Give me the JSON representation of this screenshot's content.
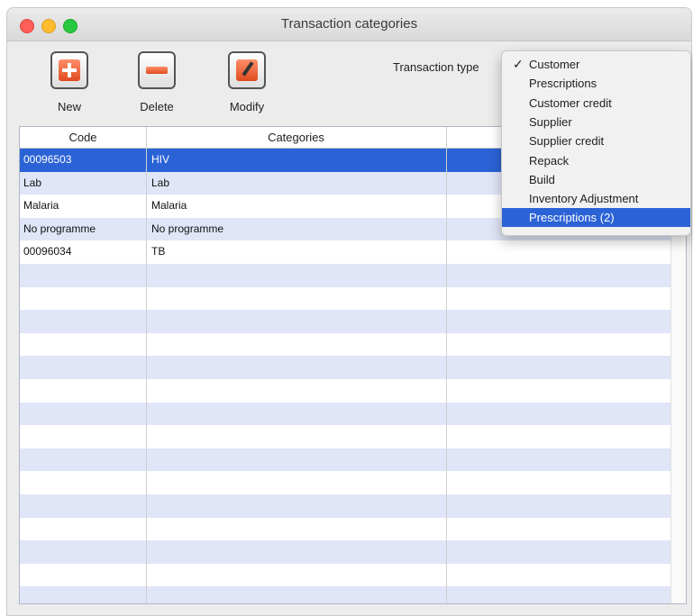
{
  "window": {
    "title": "Transaction categories"
  },
  "toolbar": {
    "new_label": "New",
    "delete_label": "Delete",
    "modify_label": "Modify"
  },
  "transaction_type": {
    "label": "Transaction type",
    "options": [
      "Customer",
      "Prescriptions",
      "Customer credit",
      "Supplier",
      "Supplier credit",
      "Repack",
      "Build",
      "Inventory Adjustment",
      "Prescriptions (2)"
    ],
    "checked_index": 0,
    "highlighted_index": 8,
    "checkmark": "✓"
  },
  "table": {
    "headers": [
      "Code",
      "Categories",
      ""
    ],
    "rows": [
      {
        "code": "00096503",
        "category": "HIV"
      },
      {
        "code": "Lab",
        "category": "Lab"
      },
      {
        "code": "Malaria",
        "category": "Malaria"
      },
      {
        "code": "No programme",
        "category": "No programme"
      },
      {
        "code": "00096034",
        "category": "TB"
      }
    ],
    "selected_row": 0
  },
  "colors": {
    "selection": "#2b63d6",
    "stripe": "#e0e6f8",
    "icon_accent": "#e04a1e"
  }
}
